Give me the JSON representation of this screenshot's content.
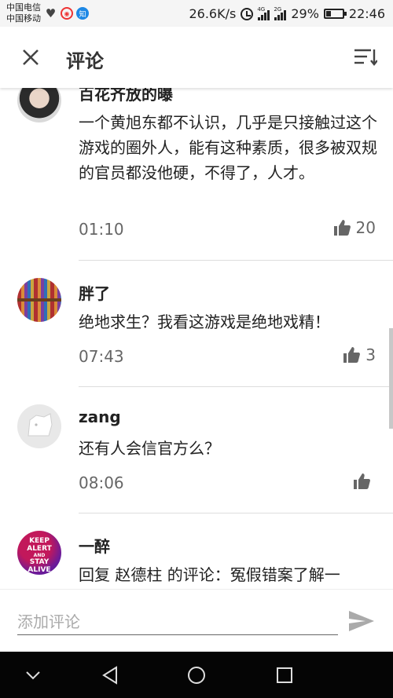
{
  "status_bar": {
    "carrier_1": "中国电信",
    "carrier_2": "中国移动",
    "net_speed": "26.6K/s",
    "network_tag_1": "4G",
    "network_tag_2": "2G",
    "battery": "29%",
    "time": "22:46",
    "icons": [
      "heart-monitor-icon",
      "weibo-icon",
      "zhihu-icon",
      "alarm-icon",
      "signal-icon",
      "battery-icon"
    ]
  },
  "header": {
    "title": "评论",
    "close_icon": "close-icon",
    "sort_icon": "sort-icon"
  },
  "comments": [
    {
      "author": "百花齐放的曝",
      "text": "一个黄旭东都不认识，几乎是只接触过这个游戏的圈外人，能有这种素质，很多被双规的官员都没他硬，不得了，人才。",
      "time": "01:10",
      "likes": "20"
    },
    {
      "author": "胖了",
      "text": "绝地求生？我看这游戏是绝地戏精！",
      "time": "07:43",
      "likes": "3"
    },
    {
      "author": "zang",
      "text": "还有人会信官方么？",
      "time": "08:06",
      "likes": ""
    },
    {
      "author": "一醉",
      "text": "回复 赵德柱 的评论：冤假错案了解一",
      "time": "",
      "likes": "",
      "avatar_text": [
        "KEEP",
        "ALERT",
        "AND",
        "STAY",
        "ALIVE"
      ]
    }
  ],
  "input": {
    "placeholder": "添加评论",
    "value": ""
  },
  "colors": {
    "status_bg": "#f5f5f5",
    "nav_bg": "#050505",
    "text_primary": "#222222",
    "text_secondary": "#666666",
    "divider": "#dddddd"
  }
}
